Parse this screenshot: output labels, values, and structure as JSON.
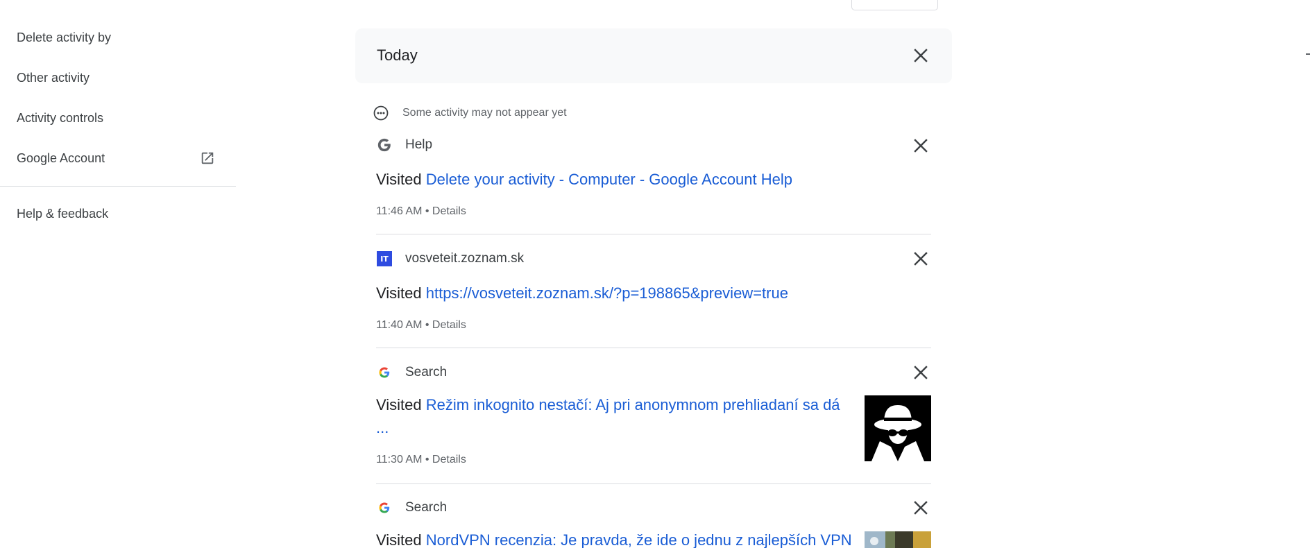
{
  "sidebar": {
    "items": [
      {
        "label": "Delete activity by"
      },
      {
        "label": "Other activity"
      },
      {
        "label": "Activity controls"
      },
      {
        "label": "Google Account",
        "icon": "open-in-new-icon"
      },
      {
        "label": "Help & feedback"
      }
    ]
  },
  "main": {
    "section_title": "Today",
    "notice": "Some activity may not appear yet",
    "visited_prefix": "Visited",
    "entries": [
      {
        "source": "Help",
        "source_icon": "google-g-gray-icon",
        "link": "Delete your activity - Computer - Google Account Help",
        "time": "11:46 AM",
        "details": "Details"
      },
      {
        "source": "vosveteit.zoznam.sk",
        "source_icon": "site-favicon-it",
        "favicon_text": "IT",
        "link": "https://vosveteit.zoznam.sk/?p=198865&preview=true",
        "time": "11:40 AM",
        "details": "Details"
      },
      {
        "source": "Search",
        "source_icon": "google-g-color-icon",
        "link": "Režim inkognito nestačí: Aj pri anonymnom prehliadaní sa dá",
        "link_cont": "...",
        "time": "11:30 AM",
        "details": "Details",
        "thumbnail": "incognito-spy-thumbnail"
      },
      {
        "source": "Search",
        "source_icon": "google-g-color-icon",
        "link": "NordVPN recenzia: Je pravda, že ide o jednu z najlepších VPN",
        "thumbnail": "article-thumbnail"
      }
    ],
    "separator": " • "
  },
  "colors": {
    "link": "#1a5dd5",
    "header_bg": "#f8f9fa",
    "divider": "#dadce0",
    "muted_text": "#5f6368",
    "favicon_it": "#2e4be0"
  }
}
